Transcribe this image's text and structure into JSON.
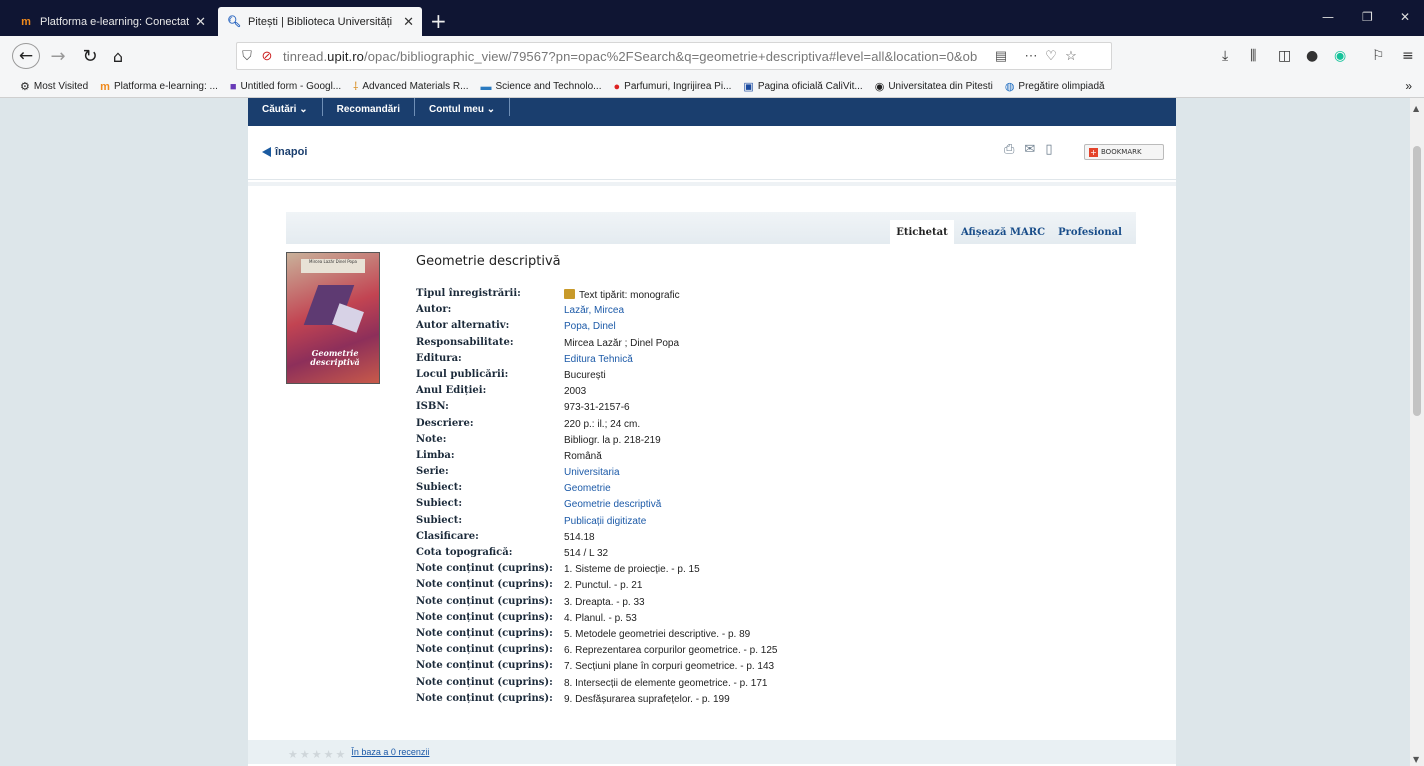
{
  "browser": {
    "tabs": [
      {
        "label": "Platforma e-learning: Conectat",
        "icon": "moodle-icon",
        "active": false
      },
      {
        "label": "Pitești | Biblioteca Universități",
        "icon": "search-icon",
        "active": true
      }
    ],
    "url_prefix": "tinread.",
    "url_domain": "upit.ro",
    "url_rest": "/opac/bibliographic_view/79567?pn=opac%2FSearch&q=geometrie+descriptiva#level=all&location=0&ob",
    "bookmarks": [
      {
        "label": "Most Visited",
        "icon": "gear-icon"
      },
      {
        "label": "Platforma e-learning: ...",
        "icon": "moodle-icon"
      },
      {
        "label": "Untitled form - Googl...",
        "icon": "form-icon"
      },
      {
        "label": "Advanced Materials R...",
        "icon": "materials-icon"
      },
      {
        "label": "Science and Technolo...",
        "icon": "science-icon"
      },
      {
        "label": "Parfumuri, Ingrijirea Pi...",
        "icon": "strawberry-icon"
      },
      {
        "label": "Pagina oficială CaliVit...",
        "icon": "calivita-icon"
      },
      {
        "label": "Universitatea din Pitesti",
        "icon": "university-icon"
      },
      {
        "label": "Pregătire olimpiadă",
        "icon": "globe-icon"
      }
    ]
  },
  "menu": {
    "items": [
      "Căutări ⌄",
      "Recomandări",
      "Contul meu ⌄"
    ]
  },
  "toolbar": {
    "back_label": "înapoi",
    "bookmark_label": "BOOKMARK"
  },
  "record_tabs": [
    "Etichetat",
    "Afișează MARC",
    "Profesional"
  ],
  "cover": {
    "authors": "Mircea Lazăr\nDinel Popa",
    "title": "Geometrie descriptivă"
  },
  "record": {
    "title": "Geometrie descriptivă",
    "fields": [
      {
        "label": "Tipul înregistrării:",
        "value": "Text tipărit: monografic",
        "link": false,
        "icon": true
      },
      {
        "label": "Autor:",
        "value": "Lazăr, Mircea",
        "link": true
      },
      {
        "label": "Autor alternativ:",
        "value": "Popa, Dinel",
        "link": true
      },
      {
        "label": "Responsabilitate:",
        "value": "Mircea Lazăr ; Dinel Popa",
        "link": false
      },
      {
        "label": "Editura:",
        "value": "Editura Tehnică",
        "link": true
      },
      {
        "label": "Locul publicării:",
        "value": "București",
        "link": false
      },
      {
        "label": "Anul Ediției:",
        "value": "2003",
        "link": false
      },
      {
        "label": "ISBN:",
        "value": "973-31-2157-6",
        "link": false
      },
      {
        "label": "Descriere:",
        "value": "220 p.: il.; 24 cm.",
        "link": false
      },
      {
        "label": "Note:",
        "value": "Bibliogr. la p. 218-219",
        "link": false
      },
      {
        "label": "Limba:",
        "value": "Română",
        "link": false
      },
      {
        "label": "Serie:",
        "value": "Universitaria",
        "link": true
      },
      {
        "label": "Subiect:",
        "value": "Geometrie",
        "link": true
      },
      {
        "label": "Subiect:",
        "value": "Geometrie descriptivă",
        "link": true
      },
      {
        "label": "Subiect:",
        "value": "Publicații digitizate",
        "link": true
      },
      {
        "label": "Clasificare:",
        "value": "514.18",
        "link": false
      },
      {
        "label": "Cota topografică:",
        "value": "514 / L 32",
        "link": false
      },
      {
        "label": "Note conținut (cuprins):",
        "value": "1. Sisteme de proiecție. - p. 15",
        "link": false
      },
      {
        "label": "Note conținut (cuprins):",
        "value": "2. Punctul. - p. 21",
        "link": false
      },
      {
        "label": "Note conținut (cuprins):",
        "value": "3. Dreapta. - p. 33",
        "link": false
      },
      {
        "label": "Note conținut (cuprins):",
        "value": "4. Planul. - p. 53",
        "link": false
      },
      {
        "label": "Note conținut (cuprins):",
        "value": "5. Metodele geometriei descriptive. - p. 89",
        "link": false
      },
      {
        "label": "Note conținut (cuprins):",
        "value": "6. Reprezentarea corpurilor geometrice. - p. 125",
        "link": false
      },
      {
        "label": "Note conținut (cuprins):",
        "value": "7. Secțiuni plane în corpuri geometrice. - p. 143",
        "link": false
      },
      {
        "label": "Note conținut (cuprins):",
        "value": "8. Intersecții de elemente geometrice. - p. 171",
        "link": false
      },
      {
        "label": "Note conținut (cuprins):",
        "value": "9. Desfășurarea suprafețelor. - p. 199",
        "link": false
      }
    ]
  },
  "rating": {
    "stars_total": 5,
    "stars_filled": 0,
    "reviews_label": "În baza a 0 recenzii"
  }
}
